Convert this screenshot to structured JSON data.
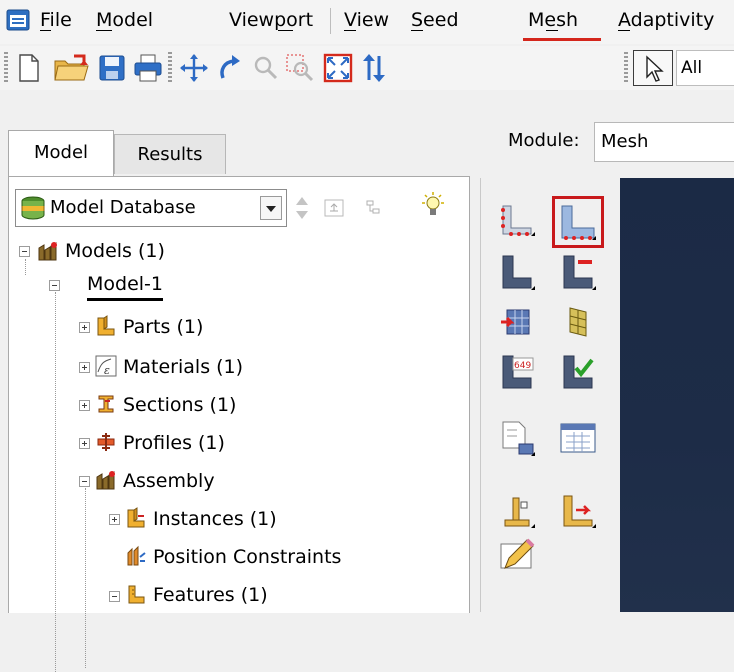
{
  "menubar": {
    "items": [
      {
        "label": "File"
      },
      {
        "label": "Model"
      },
      {
        "label": "Viewport"
      },
      {
        "label": "View"
      },
      {
        "label": "Seed"
      },
      {
        "label": "Mesh"
      },
      {
        "label": "Adaptivity"
      }
    ],
    "active_item": "Mesh",
    "accent_color": "#d4261c"
  },
  "toolbar": {
    "filter_value": "All",
    "icons": [
      "new-file-icon",
      "open-folder-icon",
      "save-icon",
      "print-icon",
      "pan-icon",
      "rotate-icon",
      "zoom-icon",
      "box-zoom-icon",
      "auto-fit-icon",
      "cycle-views-icon",
      "select-arrow-icon"
    ]
  },
  "tabs": [
    {
      "label": "Model",
      "active": true
    },
    {
      "label": "Results",
      "active": false
    }
  ],
  "database": {
    "label": "Model Database"
  },
  "tree": {
    "root": {
      "label": "Models (1)"
    },
    "model": {
      "label": "Model-1"
    },
    "items": [
      {
        "label": "Parts (1)",
        "icon": "parts-icon"
      },
      {
        "label": "Materials (1)",
        "icon": "materials-icon"
      },
      {
        "label": "Sections (1)",
        "icon": "sections-icon"
      },
      {
        "label": "Profiles (1)",
        "icon": "profiles-icon"
      },
      {
        "label": "Assembly",
        "icon": "assembly-icon"
      },
      {
        "label": "Instances (1)",
        "icon": "instances-icon"
      },
      {
        "label": "Position Constraints",
        "icon": "position-constraints-icon"
      },
      {
        "label": "Features (1)",
        "icon": "features-icon"
      }
    ]
  },
  "module": {
    "label": "Module:",
    "value": "Mesh"
  },
  "toolbox": {
    "highlight_color": "#c8191b",
    "tools": [
      "seed-part-icon",
      "seed-part-instance-icon",
      "seed-edges-icon",
      "delete-seeds-icon",
      "mesh-controls-icon",
      "element-type-icon",
      "mesh-part-icon",
      "verify-mesh-icon",
      "query-icon",
      "assign-stack-icon",
      "virtual-topology-icon",
      "edit-mesh-icon",
      "partition-icon"
    ]
  }
}
